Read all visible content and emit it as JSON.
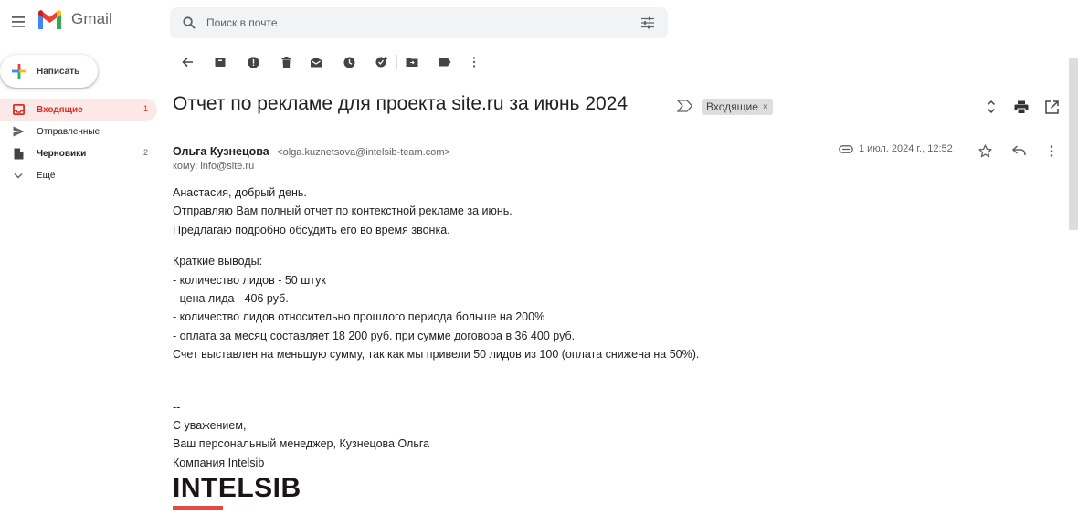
{
  "app": {
    "brand": "Gmail"
  },
  "search": {
    "placeholder": "Поиск в почте"
  },
  "compose": {
    "label": "Написать"
  },
  "nav": {
    "items": [
      {
        "label": "Входящие",
        "count": "1"
      },
      {
        "label": "Отправленные",
        "count": ""
      },
      {
        "label": "Черновики",
        "count": "2"
      },
      {
        "label": "Ещё",
        "count": ""
      }
    ]
  },
  "toolbar": {
    "icons": [
      "back-arrow-icon",
      "archive-icon",
      "report-spam-icon",
      "delete-icon",
      "mark-unread-icon",
      "snooze-icon",
      "add-task-icon",
      "move-to-icon",
      "label-icon",
      "more-vert-icon"
    ]
  },
  "message": {
    "subject": "Отчет по рекламе для проекта site.ru за июнь 2024",
    "label_chip": "Входящие",
    "label_chip_close": "×",
    "sender_name": "Ольга Кузнецова",
    "sender_email": "<olga.kuznetsova@intelsib-team.com>",
    "to_line": "кому: info@site.ru",
    "date": "1 июл. 2024 г., 12:52",
    "body": {
      "p1": "Анастасия, добрый день.",
      "p2": "Отправляю Вам полный отчет по контекстной рекламе за июнь.",
      "p3": "Предлагаю подробно обсудить его во время звонка.",
      "summary_title": "Краткие выводы:",
      "bullets": [
        "- количество лидов - 50 штук",
        "- цена лида - 406 руб.",
        "- количество лидов относительно прошлого периода больше на 200%",
        "- оплата за месяц составляет 18 200 руб. при сумме договора в 36 400 руб."
      ],
      "invoice_note": "Счет выставлен на меньшую сумму, так как мы привели 50 лидов из 100 (оплата снижена на 50%).",
      "sig_dash": "--",
      "sig_regards": "С уважением,",
      "sig_manager": "Ваш персональный менеджер, Кузнецова Ольга",
      "sig_company": "Компания Intelsib",
      "logo_text": "INTELSIB"
    }
  },
  "colors": {
    "accent_red": "#d93025",
    "active_nav_bg": "#fce8e6",
    "logo_bar": "#e8483f"
  }
}
